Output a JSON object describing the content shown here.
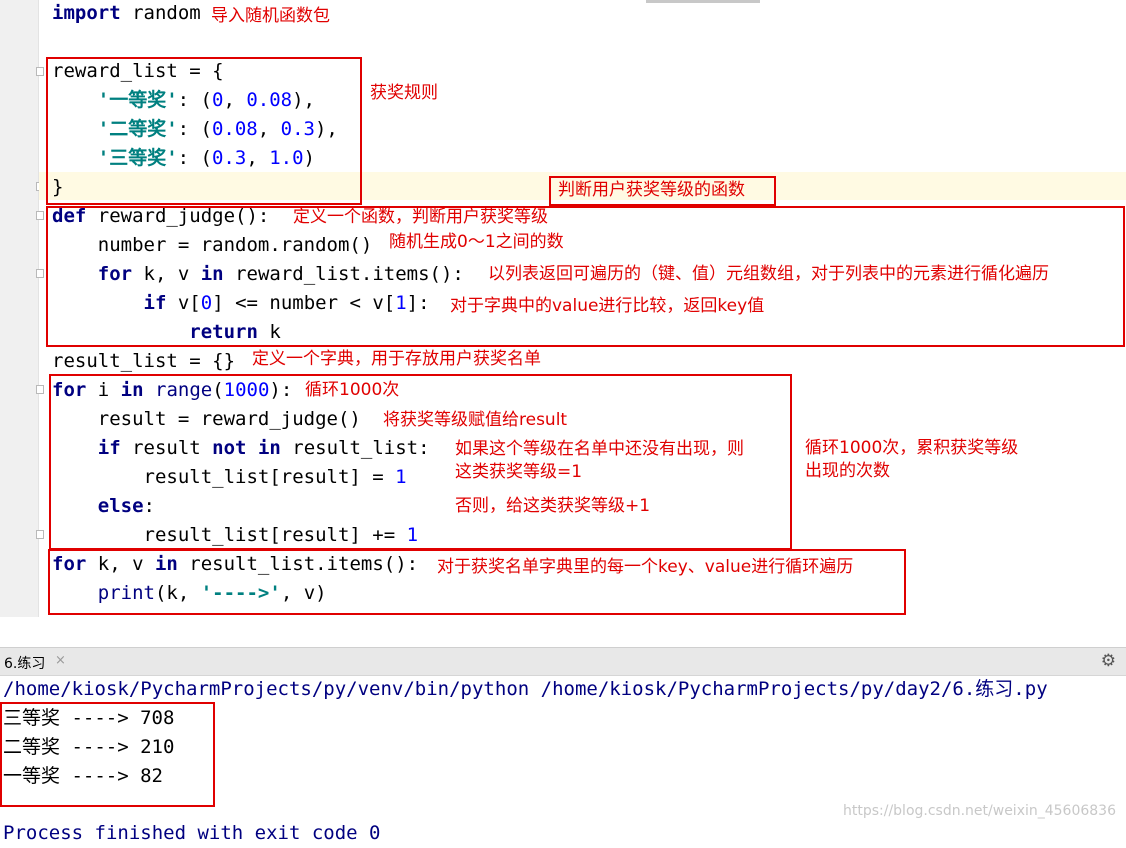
{
  "editor": {
    "lines": {
      "l1": {
        "kw": "import",
        "rest": " random"
      },
      "l3": "reward_list = {",
      "l4": {
        "indent": "    ",
        "key": "'一等奖'",
        "colon": ": (",
        "a": "0",
        "sep": ", ",
        "b": "0.08",
        "end": "),"
      },
      "l5": {
        "indent": "    ",
        "key": "'二等奖'",
        "colon": ": (",
        "a": "0.08",
        "sep": ", ",
        "b": "0.3",
        "end": "),"
      },
      "l6": {
        "indent": "    ",
        "key": "'三等奖'",
        "colon": ": (",
        "a": "0.3",
        "sep": ", ",
        "b": "1.0",
        "end": ")"
      },
      "l7": "}",
      "l8": {
        "kw": "def",
        "rest": " reward_judge():"
      },
      "l9": "    number = random.random()",
      "l10": {
        "indent": "    ",
        "kw1": "for",
        "mid": " k, v ",
        "kw2": "in",
        "rest": " reward_list.items():"
      },
      "l11": {
        "indent": "        ",
        "kw": "if",
        "a": " v[",
        "n1": "0",
        "b": "] <= number < v[",
        "n2": "1",
        "c": "]:"
      },
      "l12": {
        "indent": "            ",
        "kw": "return",
        "rest": " k"
      },
      "l13": "result_list = {}",
      "l14": {
        "kw1": "for",
        "mid": " i ",
        "kw2": "in",
        "sp": " ",
        "bi": "range",
        "p1": "(",
        "n": "1000",
        "p2": "):"
      },
      "l15": "    result = reward_judge()",
      "l16": {
        "indent": "    ",
        "kw1": "if",
        "mid": " result ",
        "kw2": "not",
        "sp": " ",
        "kw3": "in",
        "rest": " result_list:"
      },
      "l17": {
        "rest": "        result_list[result] = ",
        "n": "1"
      },
      "l18": {
        "indent": "    ",
        "kw": "else",
        "rest": ":"
      },
      "l19": {
        "rest": "        result_list[result] += ",
        "n": "1"
      },
      "l20": {
        "kw1": "for",
        "mid": " k, v ",
        "kw2": "in",
        "rest": " result_list.items():"
      },
      "l21": {
        "indent": "    ",
        "bi": "print",
        "a": "(k, ",
        "s": "'---->'",
        "b": ", v)"
      }
    }
  },
  "annotations": {
    "import_note": "导入随机函数包",
    "rules": "获奖规则",
    "judge_title": "判断用户获奖等级的函数",
    "def_note": "定义一个函数，判断用户获奖等级",
    "random_note": "随机生成0～1之间的数",
    "items_note": "以列表返回可遍历的（键、值）元组数组，对于列表中的元素进行循化遍历",
    "compare_note": "对于字典中的value进行比较，返回key值",
    "dict_note": "定义一个字典，用于存放用户获奖名单",
    "loop_note": "循环1000次",
    "assign_note": "将获奖等级赋值给result",
    "if_note_1": "如果这个等级在名单中还没有出现，则",
    "if_note_2": "这类获奖等级=1",
    "else_note": "否则，给这类获奖等级+1",
    "count_note_1": "循环1000次，累积获奖等级",
    "count_note_2": "出现的次数",
    "print_note": "对于获奖名单字典里的每一个key、value进行循环遍历"
  },
  "run": {
    "tab_label": "6.练习",
    "tab_close": "×",
    "gear": "⚙",
    "command": "/home/kiosk/PycharmProjects/py/venv/bin/python /home/kiosk/PycharmProjects/py/day2/6.练习.py",
    "results": [
      "三等奖 ----> 708",
      "二等奖 ----> 210",
      "一等奖 ----> 82"
    ],
    "finished": "Process finished with exit code 0"
  },
  "watermark": "https://blog.csdn.net/weixin_45606836",
  "colors": {
    "annotation": "#e00000",
    "keyword": "#000080",
    "number": "#0000ff",
    "string": "#008080"
  }
}
